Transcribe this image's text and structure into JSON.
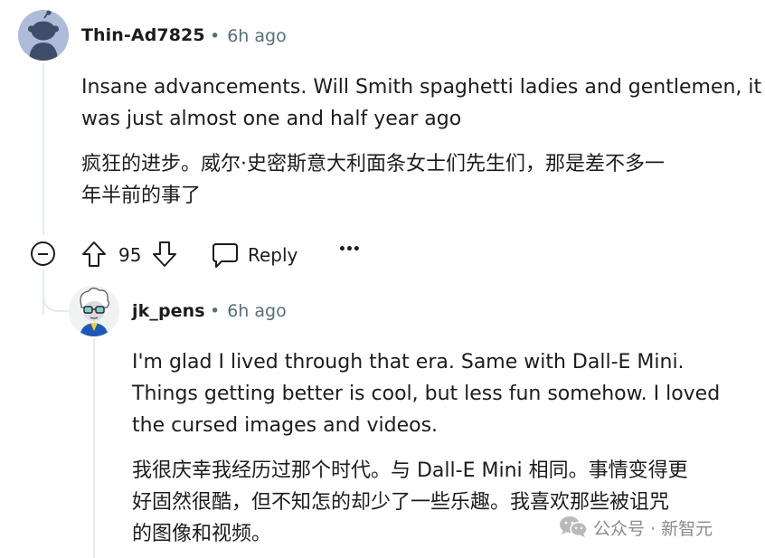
{
  "comment": {
    "username": "Thin-Ad7825",
    "separator": "•",
    "time": "6h ago",
    "body_en_line1": "Insane advancements. Will Smith spaghetti ladies and gentlemen, it",
    "body_en_line2": "was just almost one and half year ago",
    "body_zh_line1": "疯狂的进步。威尔·史密斯意大利面条女士们先生们，那是差不多一",
    "body_zh_line2": "年半前的事了",
    "vote_count": "95",
    "reply_label": "Reply",
    "more_label": "•••"
  },
  "reply": {
    "username": "jk_pens",
    "separator": "•",
    "time": "6h ago",
    "body_en_line1": "I'm glad I lived through that era. Same with Dall-E Mini.",
    "body_en_line2": "Things getting better is cool, but less fun somehow. I loved",
    "body_en_line3": "the cursed images and videos.",
    "body_zh_line1": "我很庆幸我经历过那个时代。与 Dall-E Mini 相同。事情变得更",
    "body_zh_line2": "好固然很酷，但不知怎的却少了一些乐趣。我喜欢那些被诅咒",
    "body_zh_line3": "的图像和视频。"
  },
  "watermark": {
    "text": "公众号 · 新智元"
  },
  "colors": {
    "text": "#1c1c1c",
    "meta": "#576f76",
    "thread": "#e5ebee",
    "avatar_bg": "#aab8d6"
  },
  "icons": [
    "default-avatar-icon",
    "upvote-icon",
    "downvote-icon",
    "comment-bubble-icon",
    "more-icon",
    "collapse-icon",
    "wechat-icon"
  ]
}
